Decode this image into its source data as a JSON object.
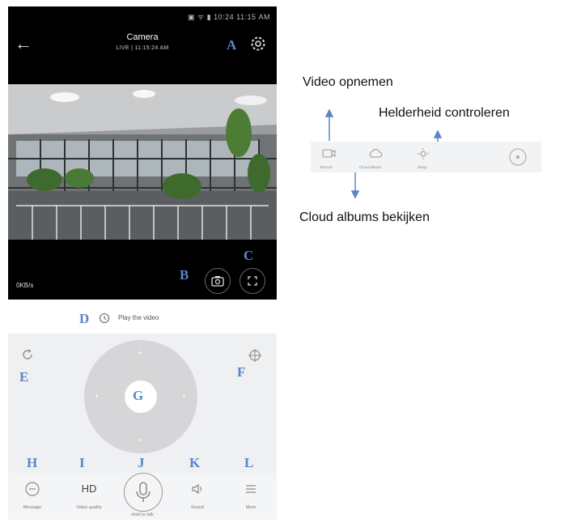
{
  "phone": {
    "status": "▣ ᯤ ▮ 10:24  11:15 AM",
    "title": "Camera",
    "subtitle": "LIVE | 11:15:24 AM",
    "speed": "0KB/s"
  },
  "labels": {
    "a": "A",
    "b": "B",
    "c": "C",
    "d": "D",
    "e": "E",
    "f": "F",
    "g": "G",
    "h": "H",
    "i": "I",
    "j": "J",
    "k": "K",
    "l": "L"
  },
  "playback": {
    "text": "Play the video"
  },
  "controls": {
    "toolbar": [
      {
        "icon": "message-icon",
        "label": "Message"
      },
      {
        "icon": "hd-icon",
        "label": "Video quality",
        "text": "HD"
      },
      {
        "icon": "microphone-icon",
        "label": "Hold to talk"
      },
      {
        "icon": "speaker-icon",
        "label": "Sound"
      },
      {
        "icon": "menu-icon",
        "label": "More"
      }
    ]
  },
  "annotations": {
    "record": "Video opnemen",
    "brightness": "Helderheid controleren",
    "cloud": "Cloud albums bekijken"
  },
  "mini_toolbar": {
    "items": [
      "Record",
      "Cloud albums",
      "Setup"
    ]
  },
  "colors": {
    "letter_blue": "#5a86c8",
    "arrow_blue": "#5a86c8"
  }
}
